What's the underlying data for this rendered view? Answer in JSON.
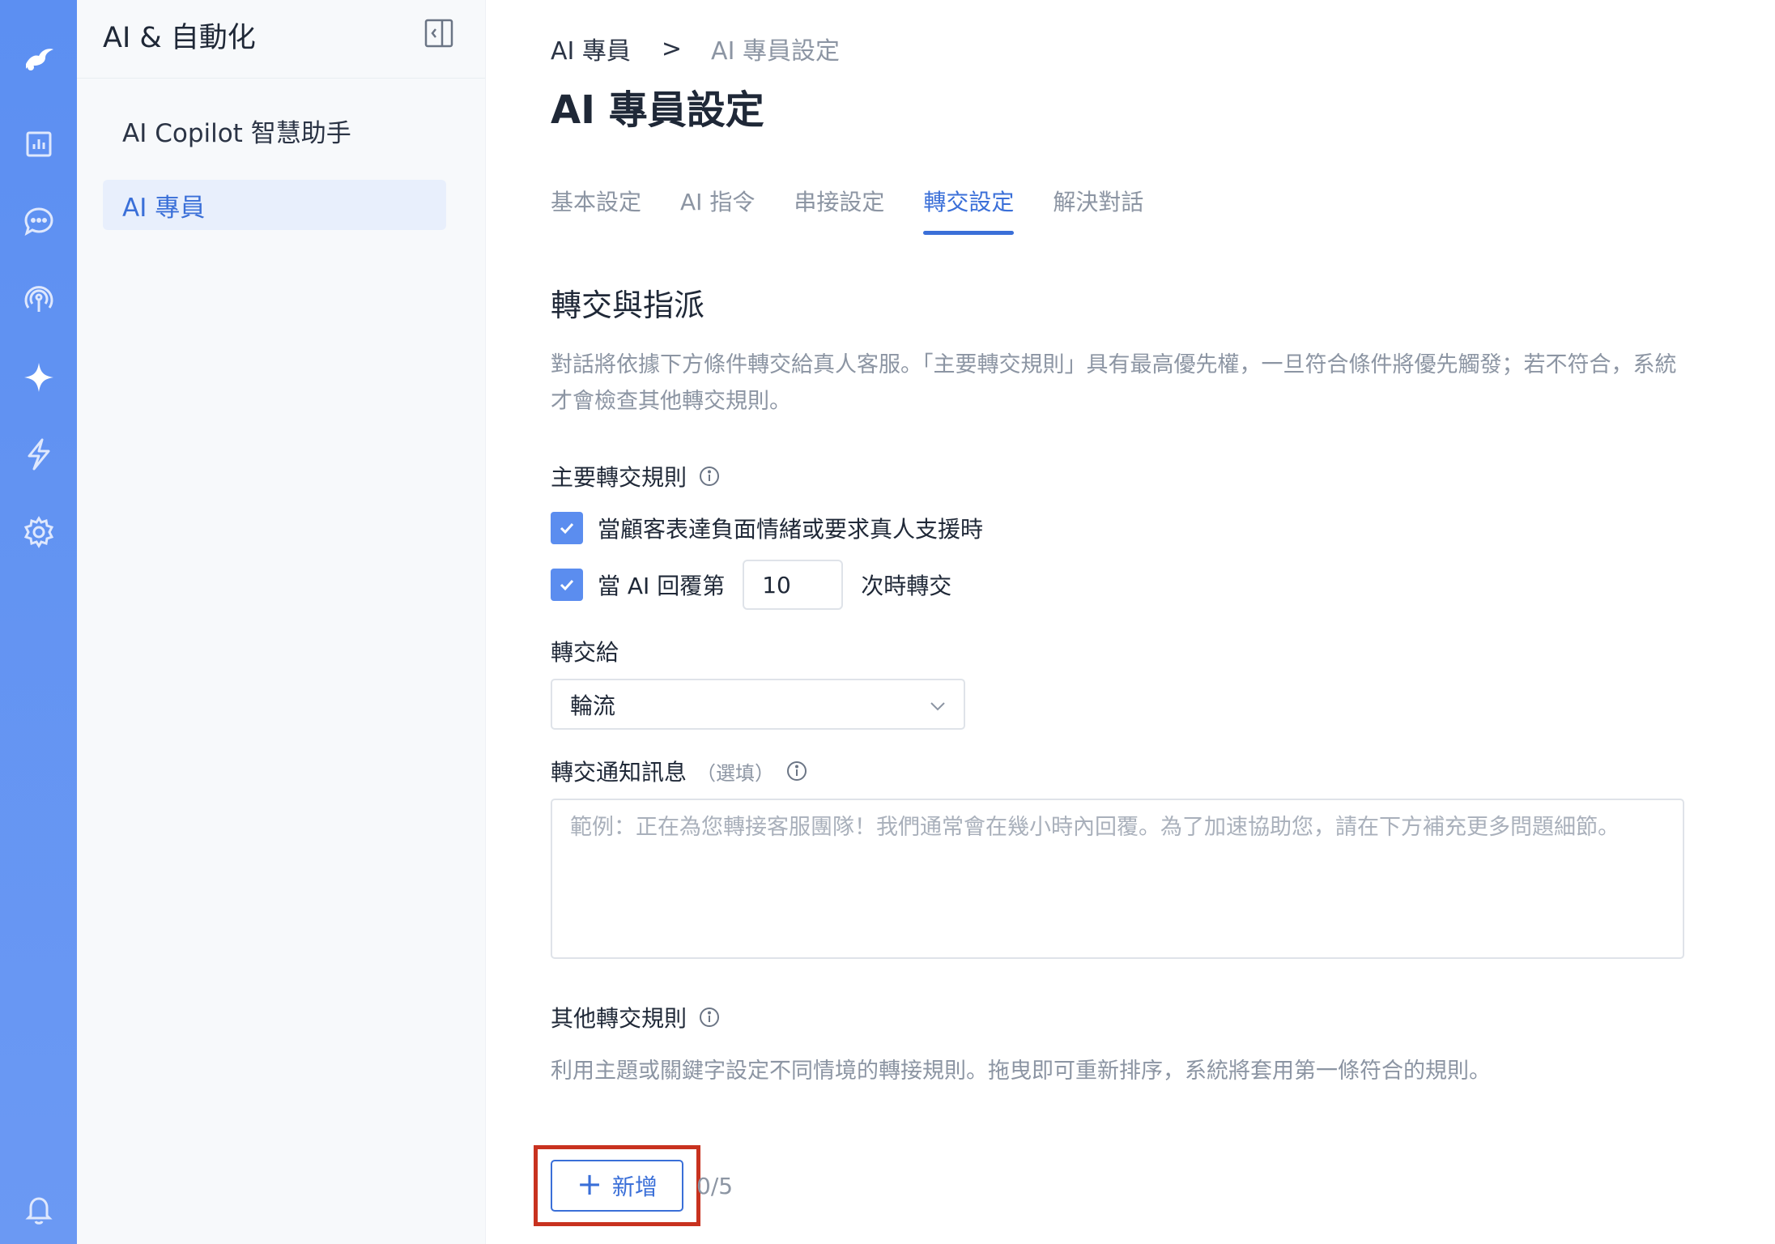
{
  "rail": {
    "items": [
      {
        "name": "logo-icon"
      },
      {
        "name": "analytics-icon"
      },
      {
        "name": "chat-icon"
      },
      {
        "name": "broadcast-icon"
      },
      {
        "name": "sparkle-icon"
      },
      {
        "name": "lightning-icon"
      },
      {
        "name": "gear-icon"
      },
      {
        "name": "bell-icon"
      }
    ]
  },
  "subnav": {
    "title": "AI & 自動化",
    "items": [
      {
        "label": "AI Copilot 智慧助手",
        "active": false
      },
      {
        "label": "AI 專員",
        "active": true
      }
    ]
  },
  "breadcrumb": {
    "parent": "AI 專員",
    "separator": ">",
    "current": "AI 專員設定"
  },
  "page_title": "AI 專員設定",
  "tabs": [
    {
      "label": "基本設定",
      "active": false
    },
    {
      "label": "AI 指令",
      "active": false
    },
    {
      "label": "串接設定",
      "active": false
    },
    {
      "label": "轉交設定",
      "active": true
    },
    {
      "label": "解決對話",
      "active": false
    }
  ],
  "section": {
    "title": "轉交與指派",
    "description": "對話將依據下方條件轉交給真人客服。「主要轉交規則」具有最高優先權，一旦符合條件將優先觸發；若不符合，系統才會檢查其他轉交規則。"
  },
  "primary_rules": {
    "label": "主要轉交規則",
    "rule1": {
      "checked": true,
      "text": "當顧客表達負面情緒或要求真人支援時"
    },
    "rule2": {
      "checked": true,
      "prefix": "當 AI 回覆第",
      "value": "10",
      "suffix": "次時轉交"
    }
  },
  "transfer_to": {
    "label": "轉交給",
    "selected": "輪流"
  },
  "notification": {
    "label": "轉交通知訊息",
    "optional": "（選填）",
    "placeholder": "範例：正在為您轉接客服團隊！我們通常會在幾小時內回覆。為了加速協助您，請在下方補充更多問題細節。"
  },
  "other_rules": {
    "label": "其他轉交規則",
    "description": "利用主題或關鍵字設定不同情境的轉接規則。拖曳即可重新排序，系統將套用第一條符合的規則。",
    "add_label": "新增",
    "counter": "0/5"
  },
  "colors": {
    "accent": "#3a6fd8",
    "rail": "#5c8ff2",
    "highlight": "#c8321f"
  }
}
